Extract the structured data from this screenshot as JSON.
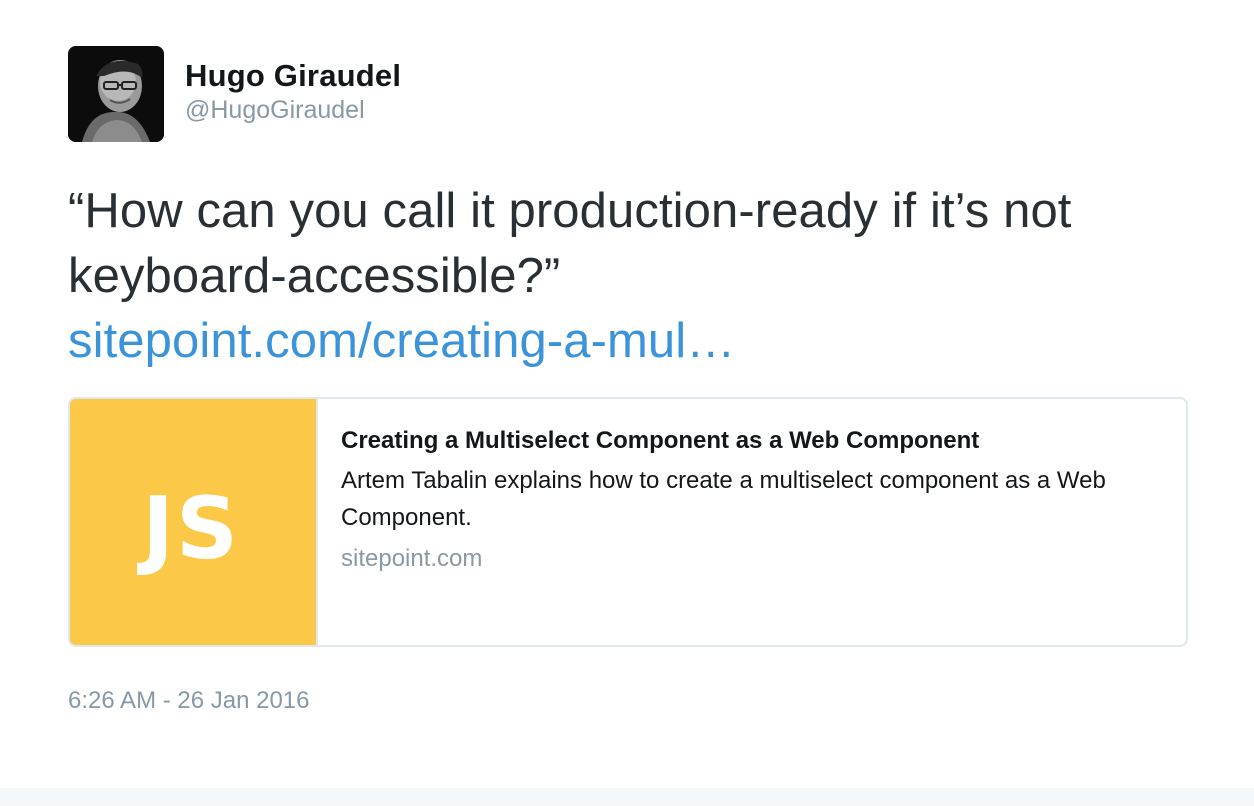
{
  "author": {
    "display_name": "Hugo Giraudel",
    "handle": "@HugoGiraudel"
  },
  "tweet": {
    "text": "“How can you call it production-ready if it’s not keyboard-accessible?”",
    "link_text": "sitepoint.com/creating-a-mul…"
  },
  "card": {
    "thumb_label": "JS",
    "thumb_color": "#fcc847",
    "title": "Creating a Multiselect Component as a Web Component",
    "description": "Artem Tabalin explains how to create a multiselect component as a Web Component.",
    "domain": "sitepoint.com"
  },
  "timestamp": "6:26 AM - 26 Jan 2016",
  "colors": {
    "link": "#3b94d9",
    "muted": "#8899a6",
    "text": "#292f33",
    "border": "#e1e8ed"
  }
}
